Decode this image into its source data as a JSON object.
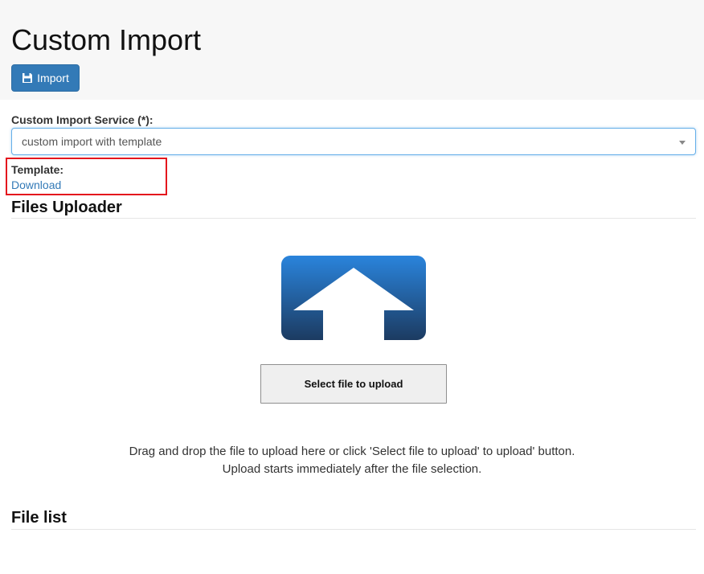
{
  "header": {
    "title": "Custom Import",
    "import_button_label": "Import",
    "import_button_icon": "floppy-disk-icon"
  },
  "form": {
    "service_label": "Custom Import Service (*):",
    "service_selected": "custom import with template",
    "template_label": "Template:",
    "template_link": "Download"
  },
  "uploader": {
    "title": "Files Uploader",
    "icon": "upload-arrow-icon",
    "select_button_label": "Select file to upload",
    "hint_line1": "Drag and drop the file to upload here or click 'Select file to upload' to upload' button.",
    "hint_line2": "Upload starts immediately after the file selection."
  },
  "file_list": {
    "title": "File list"
  },
  "colors": {
    "primary": "#337ab7",
    "highlight": "#e4161d",
    "icon_top": "#2a84dc",
    "icon_bottom": "#1c3b61"
  }
}
